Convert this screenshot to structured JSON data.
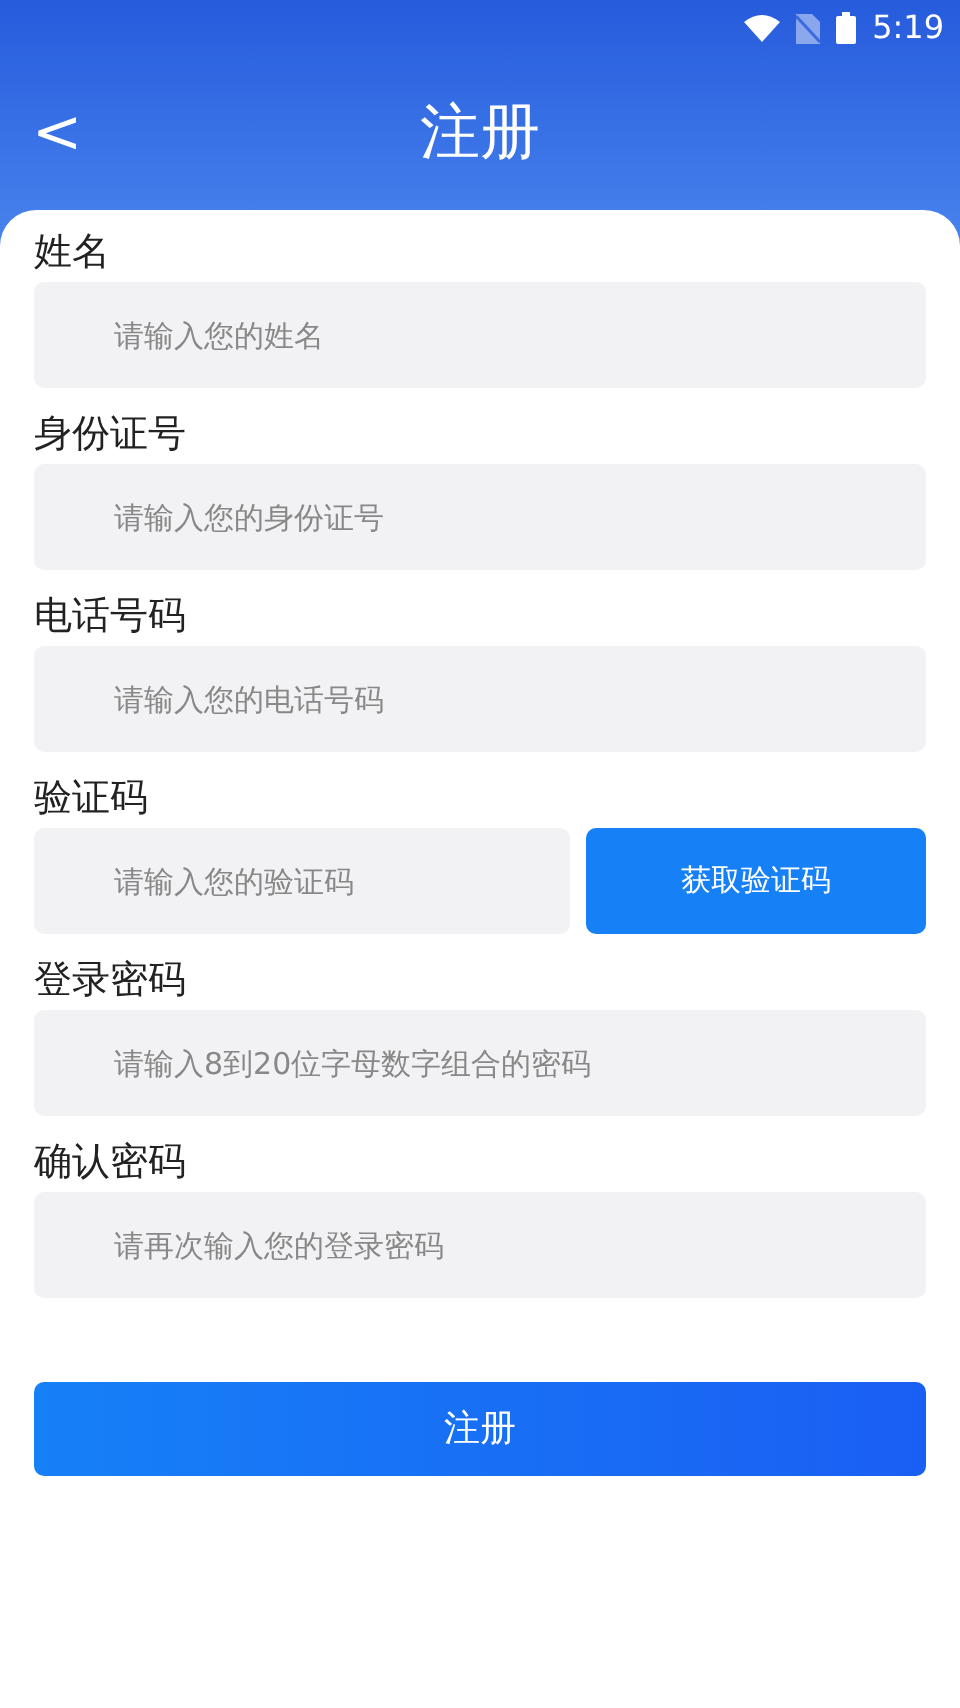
{
  "status_bar": {
    "time": "5:19"
  },
  "header": {
    "back": "<",
    "title": "注册"
  },
  "fields": [
    {
      "kind": "text",
      "label": "姓名",
      "placeholder": "请输入您的姓名"
    },
    {
      "kind": "text",
      "label": "身份证号",
      "placeholder": "请输入您的身份证号"
    },
    {
      "kind": "text",
      "label": "电话号码",
      "placeholder": "请输入您的电话号码"
    },
    {
      "kind": "code",
      "label": "验证码",
      "placeholder": "请输入您的验证码",
      "button": "获取验证码"
    },
    {
      "kind": "text",
      "label": "登录密码",
      "placeholder": "请输入8到20位字母数字组合的密码"
    },
    {
      "kind": "text",
      "label": "确认密码",
      "placeholder": "请再次输入您的登录密码"
    }
  ],
  "submit": "注册"
}
